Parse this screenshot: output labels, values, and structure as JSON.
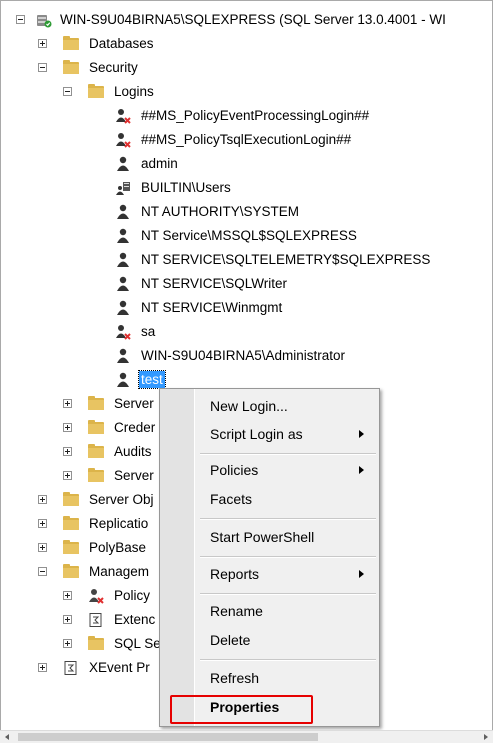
{
  "tree": {
    "server": "WIN-S9U04BIRNA5\\SQLEXPRESS (SQL Server 13.0.4001 - WI",
    "databases": "Databases",
    "security": "Security",
    "logins": "Logins",
    "login_items": [
      "##MS_PolicyEventProcessingLogin##",
      "##MS_PolicyTsqlExecutionLogin##",
      "admin",
      "BUILTIN\\Users",
      "NT AUTHORITY\\SYSTEM",
      "NT Service\\MSSQL$SQLEXPRESS",
      "NT SERVICE\\SQLTELEMETRY$SQLEXPRESS",
      "NT SERVICE\\SQLWriter",
      "NT SERVICE\\Winmgmt",
      "sa",
      "WIN-S9U04BIRNA5\\Administrator",
      "test"
    ],
    "security_children": [
      "Server",
      "Creder",
      "Audits",
      "Server"
    ],
    "server_children": [
      "Server Obj",
      "Replicatio",
      "PolyBase",
      "Managem"
    ],
    "management_children": [
      "Policy",
      "Extenc",
      "SQL Se"
    ],
    "xevent": "XEvent Pr"
  },
  "context_menu": {
    "items": [
      "New Login...",
      "Script Login as",
      "Policies",
      "Facets",
      "Start PowerShell",
      "Reports",
      "Rename",
      "Delete",
      "Refresh",
      "Properties"
    ]
  },
  "colors": {
    "selection": "#3399ff",
    "highlight_box": "#e60000",
    "folder": "#dcb44a"
  }
}
